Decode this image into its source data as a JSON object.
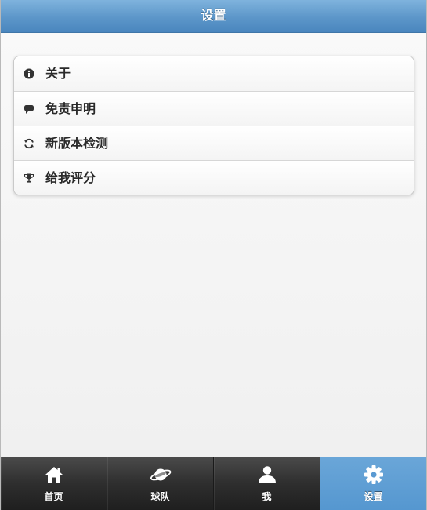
{
  "header": {
    "title": "设置"
  },
  "settings_list": {
    "items": [
      {
        "label": "关于",
        "icon": "info-icon"
      },
      {
        "label": "免责申明",
        "icon": "speech-bubble-icon"
      },
      {
        "label": "新版本检测",
        "icon": "refresh-icon"
      },
      {
        "label": "给我评分",
        "icon": "trophy-icon"
      }
    ]
  },
  "tabbar": {
    "tabs": [
      {
        "label": "首页",
        "icon": "home-icon",
        "active": false
      },
      {
        "label": "球队",
        "icon": "planet-icon",
        "active": false
      },
      {
        "label": "我",
        "icon": "user-icon",
        "active": false
      },
      {
        "label": "设置",
        "icon": "gear-icon",
        "active": true
      }
    ]
  },
  "colors": {
    "header": "#5c96c9",
    "active_tab": "#5a9ad2",
    "tabbar": "#2e2e2e"
  }
}
